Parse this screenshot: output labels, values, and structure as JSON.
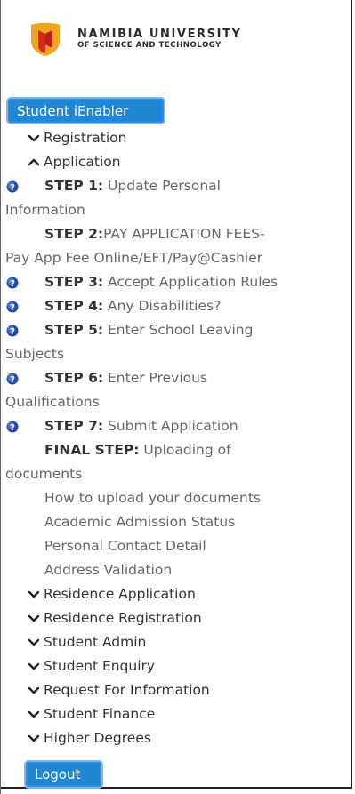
{
  "logo": {
    "line1": "NAMIBIA UNIVERSITY",
    "line2": "OF SCIENCE AND TECHNOLOGY",
    "colors": {
      "orange": "#f2a41c",
      "red": "#d7261d"
    }
  },
  "enabler_button": "Student iEnabler",
  "menu": {
    "registration": "Registration",
    "application": "Application",
    "steps": [
      {
        "num": "STEP 1:",
        "l1": " Update Personal",
        "l2": "Information",
        "icon": "help-icon"
      },
      {
        "num": "STEP 2:",
        "l1": "PAY APPLICATION FEES-",
        "l2": "Pay App Fee Online/EFT/Pay@Cashier",
        "icon": ""
      },
      {
        "num": "STEP 3:",
        "l1": " Accept Application Rules",
        "icon": "help-icon"
      },
      {
        "num": "STEP 4:",
        "l1": " Any Disabilities?",
        "icon": "help-icon"
      },
      {
        "num": "STEP 5:",
        "l1": " Enter School Leaving",
        "l2": "Subjects",
        "icon": "help-icon"
      },
      {
        "num": "STEP 6:",
        "l1": " Enter Previous",
        "l2": "Qualifications",
        "icon": "help-icon"
      },
      {
        "num": "STEP 7:",
        "l1": " Submit Application",
        "icon": "help-icon"
      },
      {
        "num": "FINAL STEP:",
        "l1": " Uploading of",
        "l2": "documents",
        "icon": ""
      }
    ],
    "sub_links": [
      "How to upload your documents",
      "Academic Admission Status",
      "Personal Contact Detail",
      "Address Validation"
    ],
    "collapsed_sections": [
      "Residence Application",
      "Residence Registration",
      "Student Admin",
      "Student Enquiry",
      "Request For Information",
      "Student Finance",
      "Higher Degrees"
    ]
  },
  "logout_button": "Logout"
}
